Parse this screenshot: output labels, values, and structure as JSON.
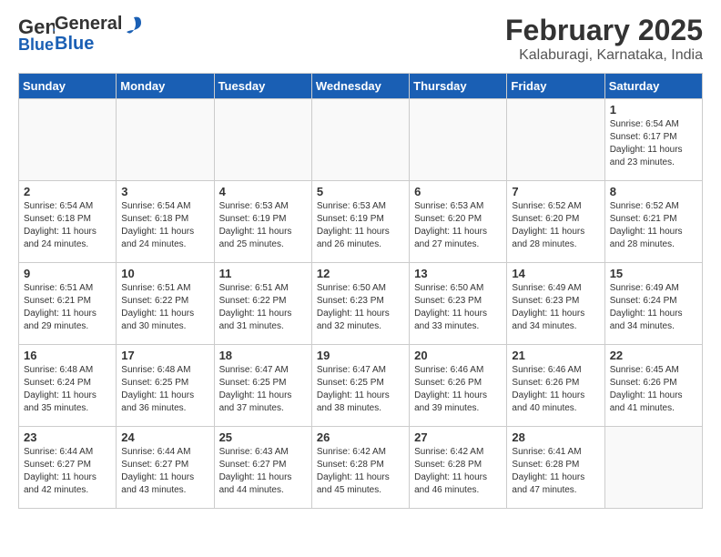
{
  "header": {
    "logo_general": "General",
    "logo_blue": "Blue",
    "title": "February 2025",
    "subtitle": "Kalaburagi, Karnataka, India"
  },
  "weekdays": [
    "Sunday",
    "Monday",
    "Tuesday",
    "Wednesday",
    "Thursday",
    "Friday",
    "Saturday"
  ],
  "weeks": [
    [
      {
        "day": "",
        "info": ""
      },
      {
        "day": "",
        "info": ""
      },
      {
        "day": "",
        "info": ""
      },
      {
        "day": "",
        "info": ""
      },
      {
        "day": "",
        "info": ""
      },
      {
        "day": "",
        "info": ""
      },
      {
        "day": "1",
        "info": "Sunrise: 6:54 AM\nSunset: 6:17 PM\nDaylight: 11 hours\nand 23 minutes."
      }
    ],
    [
      {
        "day": "2",
        "info": "Sunrise: 6:54 AM\nSunset: 6:18 PM\nDaylight: 11 hours\nand 24 minutes."
      },
      {
        "day": "3",
        "info": "Sunrise: 6:54 AM\nSunset: 6:18 PM\nDaylight: 11 hours\nand 24 minutes."
      },
      {
        "day": "4",
        "info": "Sunrise: 6:53 AM\nSunset: 6:19 PM\nDaylight: 11 hours\nand 25 minutes."
      },
      {
        "day": "5",
        "info": "Sunrise: 6:53 AM\nSunset: 6:19 PM\nDaylight: 11 hours\nand 26 minutes."
      },
      {
        "day": "6",
        "info": "Sunrise: 6:53 AM\nSunset: 6:20 PM\nDaylight: 11 hours\nand 27 minutes."
      },
      {
        "day": "7",
        "info": "Sunrise: 6:52 AM\nSunset: 6:20 PM\nDaylight: 11 hours\nand 28 minutes."
      },
      {
        "day": "8",
        "info": "Sunrise: 6:52 AM\nSunset: 6:21 PM\nDaylight: 11 hours\nand 28 minutes."
      }
    ],
    [
      {
        "day": "9",
        "info": "Sunrise: 6:51 AM\nSunset: 6:21 PM\nDaylight: 11 hours\nand 29 minutes."
      },
      {
        "day": "10",
        "info": "Sunrise: 6:51 AM\nSunset: 6:22 PM\nDaylight: 11 hours\nand 30 minutes."
      },
      {
        "day": "11",
        "info": "Sunrise: 6:51 AM\nSunset: 6:22 PM\nDaylight: 11 hours\nand 31 minutes."
      },
      {
        "day": "12",
        "info": "Sunrise: 6:50 AM\nSunset: 6:23 PM\nDaylight: 11 hours\nand 32 minutes."
      },
      {
        "day": "13",
        "info": "Sunrise: 6:50 AM\nSunset: 6:23 PM\nDaylight: 11 hours\nand 33 minutes."
      },
      {
        "day": "14",
        "info": "Sunrise: 6:49 AM\nSunset: 6:23 PM\nDaylight: 11 hours\nand 34 minutes."
      },
      {
        "day": "15",
        "info": "Sunrise: 6:49 AM\nSunset: 6:24 PM\nDaylight: 11 hours\nand 34 minutes."
      }
    ],
    [
      {
        "day": "16",
        "info": "Sunrise: 6:48 AM\nSunset: 6:24 PM\nDaylight: 11 hours\nand 35 minutes."
      },
      {
        "day": "17",
        "info": "Sunrise: 6:48 AM\nSunset: 6:25 PM\nDaylight: 11 hours\nand 36 minutes."
      },
      {
        "day": "18",
        "info": "Sunrise: 6:47 AM\nSunset: 6:25 PM\nDaylight: 11 hours\nand 37 minutes."
      },
      {
        "day": "19",
        "info": "Sunrise: 6:47 AM\nSunset: 6:25 PM\nDaylight: 11 hours\nand 38 minutes."
      },
      {
        "day": "20",
        "info": "Sunrise: 6:46 AM\nSunset: 6:26 PM\nDaylight: 11 hours\nand 39 minutes."
      },
      {
        "day": "21",
        "info": "Sunrise: 6:46 AM\nSunset: 6:26 PM\nDaylight: 11 hours\nand 40 minutes."
      },
      {
        "day": "22",
        "info": "Sunrise: 6:45 AM\nSunset: 6:26 PM\nDaylight: 11 hours\nand 41 minutes."
      }
    ],
    [
      {
        "day": "23",
        "info": "Sunrise: 6:44 AM\nSunset: 6:27 PM\nDaylight: 11 hours\nand 42 minutes."
      },
      {
        "day": "24",
        "info": "Sunrise: 6:44 AM\nSunset: 6:27 PM\nDaylight: 11 hours\nand 43 minutes."
      },
      {
        "day": "25",
        "info": "Sunrise: 6:43 AM\nSunset: 6:27 PM\nDaylight: 11 hours\nand 44 minutes."
      },
      {
        "day": "26",
        "info": "Sunrise: 6:42 AM\nSunset: 6:28 PM\nDaylight: 11 hours\nand 45 minutes."
      },
      {
        "day": "27",
        "info": "Sunrise: 6:42 AM\nSunset: 6:28 PM\nDaylight: 11 hours\nand 46 minutes."
      },
      {
        "day": "28",
        "info": "Sunrise: 6:41 AM\nSunset: 6:28 PM\nDaylight: 11 hours\nand 47 minutes."
      },
      {
        "day": "",
        "info": ""
      }
    ]
  ]
}
